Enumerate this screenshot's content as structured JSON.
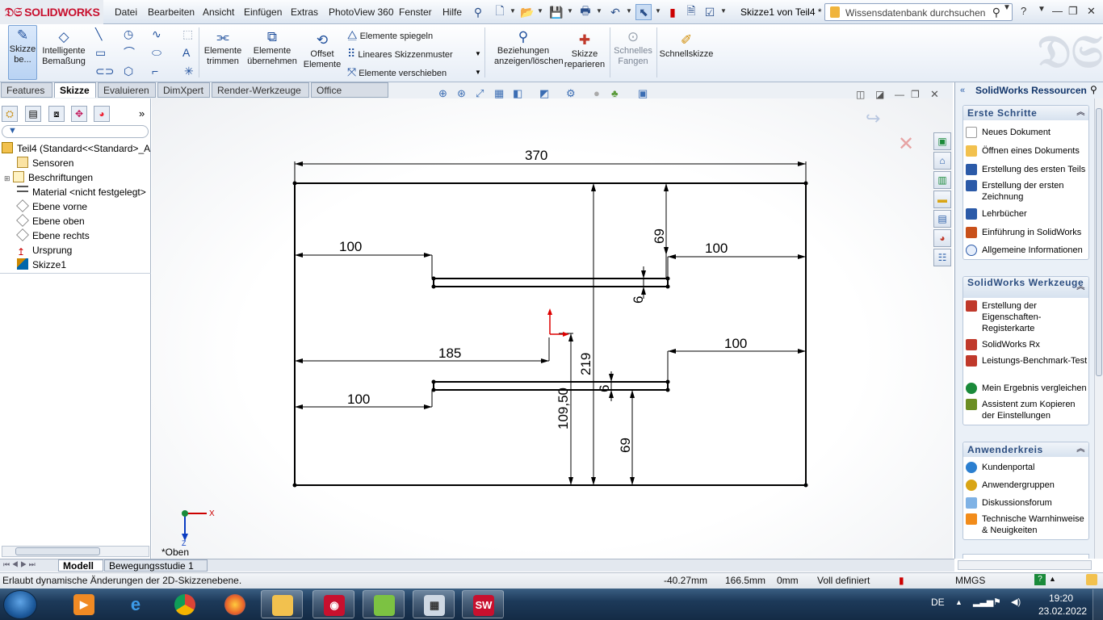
{
  "app": {
    "brand": "SOLIDWORKS",
    "doc_title": "Skizze1 von Teil4 *"
  },
  "menu": [
    "Datei",
    "Bearbeiten",
    "Ansicht",
    "Einfügen",
    "Extras",
    "PhotoView 360",
    "Fenster",
    "Hilfe"
  ],
  "search": {
    "placeholder": "Wissensdatenbank durchsuchen"
  },
  "command": {
    "sketch_label": "Skizze be...",
    "smart_dim": "Intelligente Bemaßung",
    "trim": "Elemente trimmen",
    "convert": "Elemente übernehmen",
    "offset": "Offset Elemente",
    "mirror": "Elemente spiegeln",
    "pattern": "Lineares Skizzenmuster",
    "move": "Elemente verschieben",
    "relations": "Beziehungen anzeigen/löschen",
    "repair": "Skizze reparieren",
    "snap": "Schnelles Fangen",
    "rapid": "Schnellskizze"
  },
  "tabs": [
    "Features",
    "Skizze",
    "Evaluieren",
    "DimXpert",
    "Render-Werkzeuge",
    "Office Produkte"
  ],
  "active_tab": "Skizze",
  "tree": [
    {
      "label": "Teil4  (Standard<<Standard>_A",
      "icon": "part-icon"
    },
    {
      "label": "Sensoren",
      "icon": "sensor-icon"
    },
    {
      "label": "Beschriftungen",
      "icon": "annotation-icon"
    },
    {
      "label": "Material <nicht festgelegt>",
      "icon": "material-icon"
    },
    {
      "label": "Ebene vorne",
      "icon": "plane-icon"
    },
    {
      "label": "Ebene oben",
      "icon": "plane-icon"
    },
    {
      "label": "Ebene rechts",
      "icon": "plane-icon"
    },
    {
      "label": "Ursprung",
      "icon": "origin-icon"
    },
    {
      "label": "Skizze1",
      "icon": "sketch-icon"
    }
  ],
  "drawing": {
    "dims": {
      "width": "370",
      "top_left": "100",
      "top_right": "100",
      "top_vertical": "69",
      "slot_gap_top": "6",
      "mid_left": "185",
      "mid_right": "100",
      "bottom_left": "100",
      "height": "219",
      "slot_gap_bottom": "6",
      "mid_height": "109,50",
      "bottom_vertical": "69"
    },
    "view_label": "*Oben",
    "axis_x": "X",
    "axis_z": "Z"
  },
  "taskpane": {
    "title": "SolidWorks Ressourcen",
    "groups": [
      {
        "title": "Erste Schritte",
        "items": [
          "Neues Dokument",
          "Öffnen eines Dokuments",
          "Erstellung des ersten Teils",
          "Erstellung der ersten Zeichnung",
          "Lehrbücher",
          "Einführung in SolidWorks",
          "Allgemeine Informationen"
        ]
      },
      {
        "title": "SolidWorks Werkzeuge",
        "items": [
          "Erstellung der Eigenschaften-Registerkarte",
          "SolidWorks Rx",
          "Leistungs-Benchmark-Test",
          "Mein Ergebnis vergleichen",
          "Assistent zum Kopieren der Einstellungen"
        ]
      },
      {
        "title": "Anwenderkreis",
        "items": [
          "Kundenportal",
          "Anwendergruppen",
          "Diskussionsforum",
          "Technische Warnhinweise & Neuigkeiten"
        ]
      }
    ]
  },
  "model_tabs": [
    "Modell",
    "Bewegungsstudie 1"
  ],
  "status": {
    "hint": "Erlaubt dynamische Änderungen der 2D-Skizzenebene.",
    "x": "-40.27mm",
    "y": "166.5mm",
    "z": "0mm",
    "state": "Voll definiert",
    "units": "MMGS"
  },
  "taskbar": {
    "lang": "DE",
    "time": "19:20",
    "date": "23.02.2022"
  },
  "colors": {
    "brand": "#c8102e",
    "accent": "#1f4f9c",
    "taskbar": "#1d3a5a"
  }
}
